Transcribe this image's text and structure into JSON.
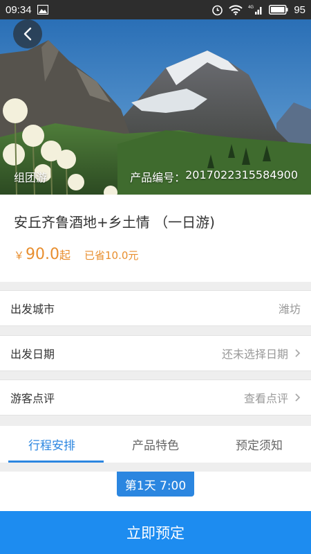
{
  "status_bar": {
    "time": "09:34",
    "battery": "95",
    "network": "4G"
  },
  "hero": {
    "tour_type": "组团游",
    "code_label": "产品编号：",
    "code_value": "2017022315584900"
  },
  "product": {
    "title": "安丘齐鲁酒地+乡土情 （一日游)",
    "currency": "￥",
    "price": "90.0",
    "price_suffix": "起",
    "saved": "已省10.0元"
  },
  "rows": [
    {
      "label": "出发城市",
      "value": "潍坊"
    },
    {
      "label": "出发日期",
      "value": "还未选择日期"
    },
    {
      "label": "游客点评",
      "value": "查看点评"
    }
  ],
  "tabs": [
    {
      "label": "行程安排",
      "active": true
    },
    {
      "label": "产品特色",
      "active": false
    },
    {
      "label": "预定须知",
      "active": false
    }
  ],
  "schedule": {
    "day_label": "第1天 7:00"
  },
  "book_button": "立即预定",
  "colors": {
    "accent": "#2b86e0",
    "price": "#e88e2e",
    "book": "#1d8cf0"
  }
}
